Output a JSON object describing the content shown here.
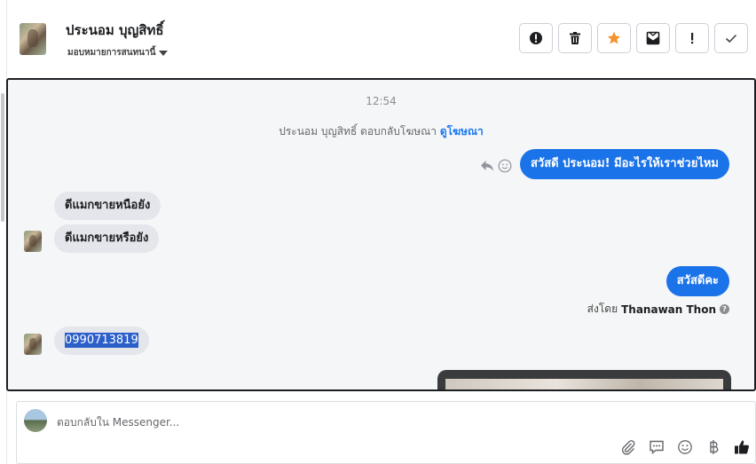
{
  "header": {
    "contact_name": "ประนอม บุญสิทธิ์",
    "assign_label": "มอบหมายการสนทนานี้",
    "actions": [
      {
        "name": "spam-button",
        "icon": "alert-circle-icon"
      },
      {
        "name": "delete-button",
        "icon": "trash-icon"
      },
      {
        "name": "star-button",
        "icon": "star-icon"
      },
      {
        "name": "mark-unread-button",
        "icon": "envelope-icon"
      },
      {
        "name": "follow-up-button",
        "icon": "exclamation-icon"
      },
      {
        "name": "done-button",
        "icon": "check-icon"
      }
    ]
  },
  "thread": {
    "timestamp": "12:54",
    "ad_reply_text": "ประนอม บุญสิทธิ์ ตอบกลับโฆษณา",
    "ad_link": "ดูโฆษณา",
    "messages": [
      {
        "dir": "out",
        "text": "สวัสดี ประนอม! มีอะไรให้เราช่วยไหม"
      },
      {
        "dir": "in",
        "text": "ดีแมกขายหนือยัง"
      },
      {
        "dir": "in",
        "text": "ดีแมกขายหรือยัง"
      },
      {
        "dir": "out",
        "text": "สวัสดีคะ"
      },
      {
        "dir": "in",
        "text": "0990713819"
      }
    ],
    "sent_by_label": "ส่งโดย",
    "sent_by_name": "Thanawan Thon",
    "colors": {
      "outgoing": "#1a73e8",
      "incoming": "#e4e6eb",
      "selection": "#2b5fc9"
    }
  },
  "composer": {
    "placeholder": "ตอบกลับใน Messenger...",
    "tools": [
      "paperclip-icon",
      "saved-reply-icon",
      "emoji-icon",
      "baht-icon",
      "thumbs-up-icon"
    ]
  }
}
